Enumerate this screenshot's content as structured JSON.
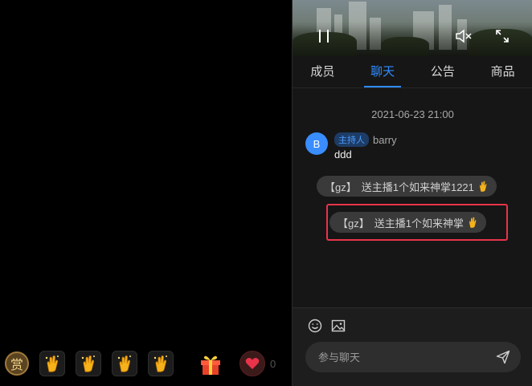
{
  "gift_bar": {
    "reward_label": "赏",
    "gift_count": 4,
    "like_count": "0"
  },
  "video": {
    "pause_icon": "pause-icon",
    "mute_icon": "volume-mute-icon",
    "fullscreen_icon": "fullscreen-icon"
  },
  "tabs": [
    {
      "label": "成员",
      "active": false
    },
    {
      "label": "聊天",
      "active": true
    },
    {
      "label": "公告",
      "active": false
    },
    {
      "label": "商品",
      "active": false
    }
  ],
  "chat": {
    "timestamp": "2021-06-23 21:00",
    "message": {
      "avatar_letter": "B",
      "badge": "主持人",
      "username": "barry",
      "text": "ddd"
    },
    "gift_notices": [
      {
        "tag": "【gz】",
        "text": "送主播1个如来神掌1221"
      },
      {
        "tag": "【gz】",
        "text": "送主播1个如来神掌"
      }
    ]
  },
  "input": {
    "placeholder": "参与聊天"
  },
  "colors": {
    "accent": "#2f8cff",
    "highlight": "#e8334a",
    "avatar": "#3a8dff"
  }
}
